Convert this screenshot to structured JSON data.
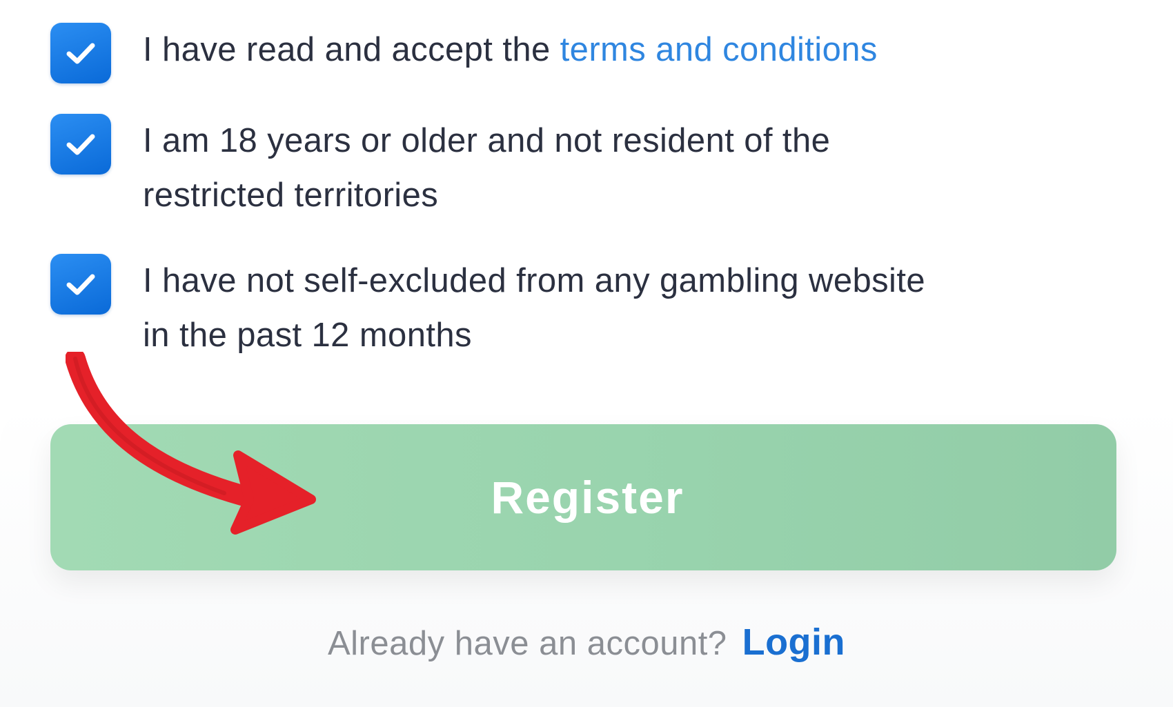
{
  "terms": {
    "checkboxes": [
      {
        "checked": true,
        "text": "I have read and accept the ",
        "link_text": "terms and conditions"
      },
      {
        "checked": true,
        "text": "I am 18 years or older and not resident of the restricted territories"
      },
      {
        "checked": true,
        "text": "I have not self-excluded from any gambling website in the past 12 months"
      }
    ]
  },
  "actions": {
    "register_label": "Register",
    "login_prompt": "Already have an account?",
    "login_link": "Login"
  },
  "annotation": {
    "arrow_icon": "curved-arrow-icon",
    "arrow_color": "#e52129"
  },
  "colors": {
    "checkbox": "#1a7ae6",
    "link": "#2f86e0",
    "register_button": "#9dd6b0",
    "login_link": "#1a6fd1",
    "text": "#2b3040"
  }
}
